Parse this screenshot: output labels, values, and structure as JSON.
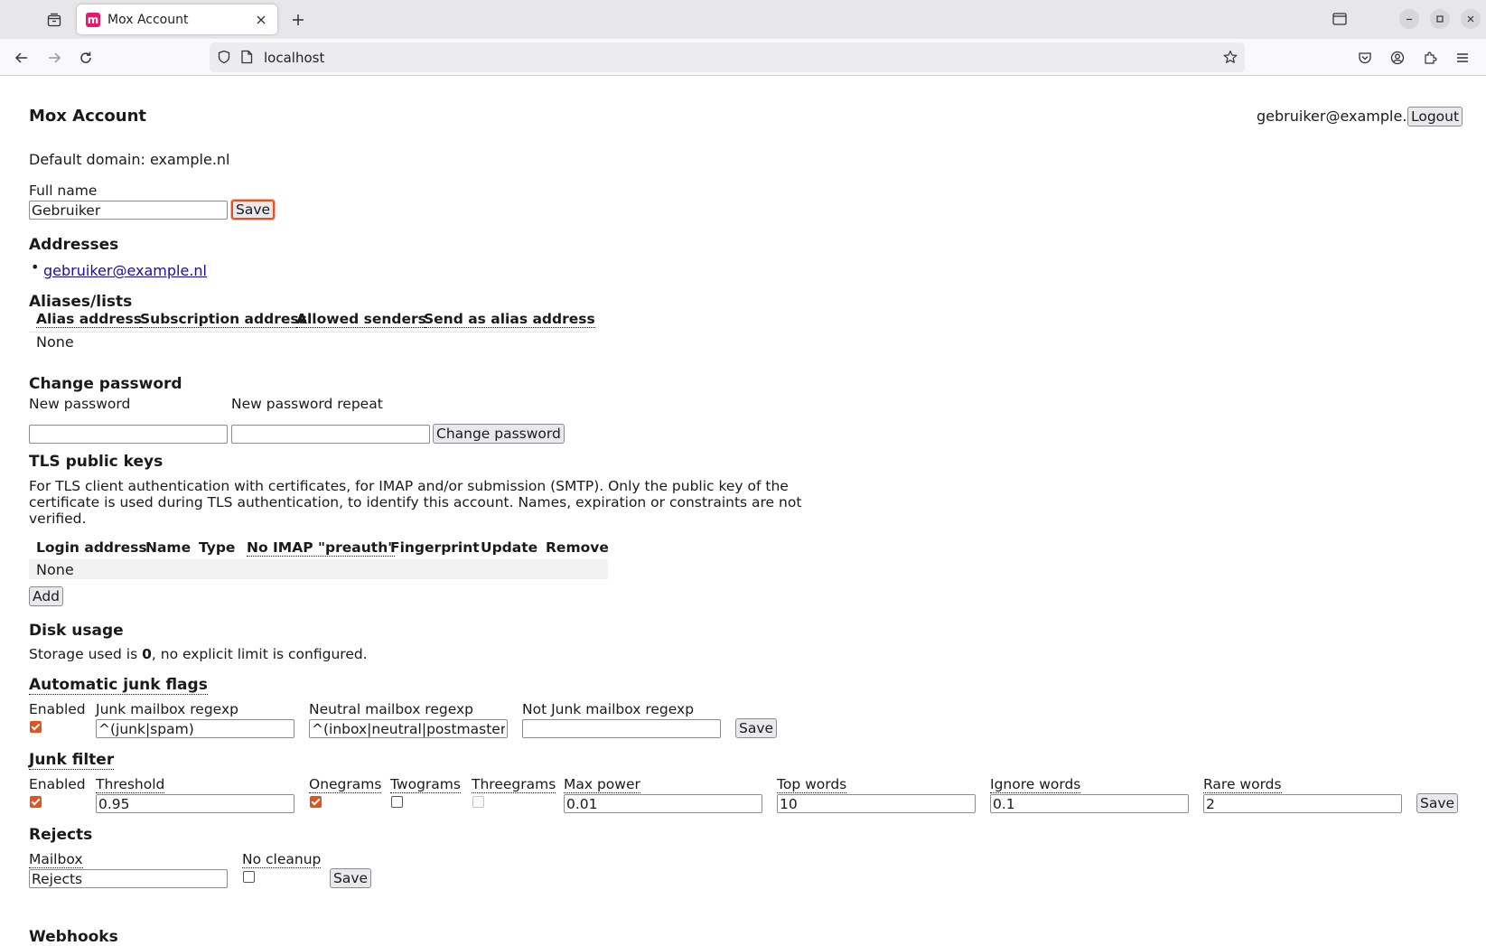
{
  "browser": {
    "tab_title": "Mox Account",
    "url": "localhost",
    "favicon_letter": "m",
    "favicon_color": "#e8186e"
  },
  "header": {
    "title": "Mox Account",
    "user": "gebruiker@example.nl",
    "logout_label": "Logout"
  },
  "default_domain": "Default domain: example.nl",
  "full_name": {
    "label": "Full name",
    "value": "Gebruiker",
    "save_label": "Save"
  },
  "addresses": {
    "heading": "Addresses",
    "items": [
      "gebruiker@example.nl"
    ]
  },
  "aliases": {
    "heading": "Aliases/lists",
    "columns": [
      "Alias address",
      "Subscription address",
      "Allowed senders",
      "Send as alias address"
    ],
    "empty": "None"
  },
  "change_password": {
    "heading": "Change password",
    "new_label": "New password",
    "repeat_label": "New password repeat",
    "button_label": "Change password"
  },
  "tls": {
    "heading": "TLS public keys",
    "description_line1": "For TLS client authentication with certificates, for IMAP and/or submission (SMTP). Only the public key of the",
    "description_line2": "certificate is used during TLS authentication, to identify this account. Names, expiration or constraints are not",
    "description_line3": "verified.",
    "columns": [
      "Login address",
      "Name",
      "Type",
      "No IMAP \"preauth\"",
      "Fingerprint",
      "Update",
      "Remove"
    ],
    "empty": "None",
    "add_label": "Add"
  },
  "disk": {
    "heading": "Disk usage",
    "prefix": "Storage used is ",
    "used": "0",
    "suffix": ", no explicit limit is configured."
  },
  "junk_flags": {
    "heading": "Automatic junk flags",
    "enabled_label": "Enabled",
    "enabled": true,
    "junk_label": "Junk mailbox regexp",
    "junk_value": "^(junk|spam)",
    "neutral_label": "Neutral mailbox regexp",
    "neutral_value": "^(inbox|neutral|postmaster|dr",
    "notjunk_label": "Not Junk mailbox regexp",
    "notjunk_value": "",
    "save_label": "Save"
  },
  "junk_filter": {
    "heading": "Junk filter",
    "enabled_label": "Enabled",
    "enabled": true,
    "threshold_label": "Threshold",
    "threshold_value": "0.95",
    "onegrams_label": "Onegrams",
    "onegrams": true,
    "twograms_label": "Twograms",
    "twograms": false,
    "threegrams_label": "Threegrams",
    "threegrams": false,
    "maxpower_label": "Max power",
    "maxpower_value": "0.01",
    "topwords_label": "Top words",
    "topwords_value": "10",
    "ignorewords_label": "Ignore words",
    "ignorewords_value": "0.1",
    "rarewords_label": "Rare words",
    "rarewords_value": "2",
    "save_label": "Save"
  },
  "rejects": {
    "heading": "Rejects",
    "mailbox_label": "Mailbox",
    "mailbox_value": "Rejects",
    "nocleanup_label": "No cleanup",
    "nocleanup": false,
    "save_label": "Save"
  },
  "webhooks": {
    "heading": "Webhooks"
  },
  "colors": {
    "accent": "#e2531f",
    "link": "#1a0dab"
  }
}
